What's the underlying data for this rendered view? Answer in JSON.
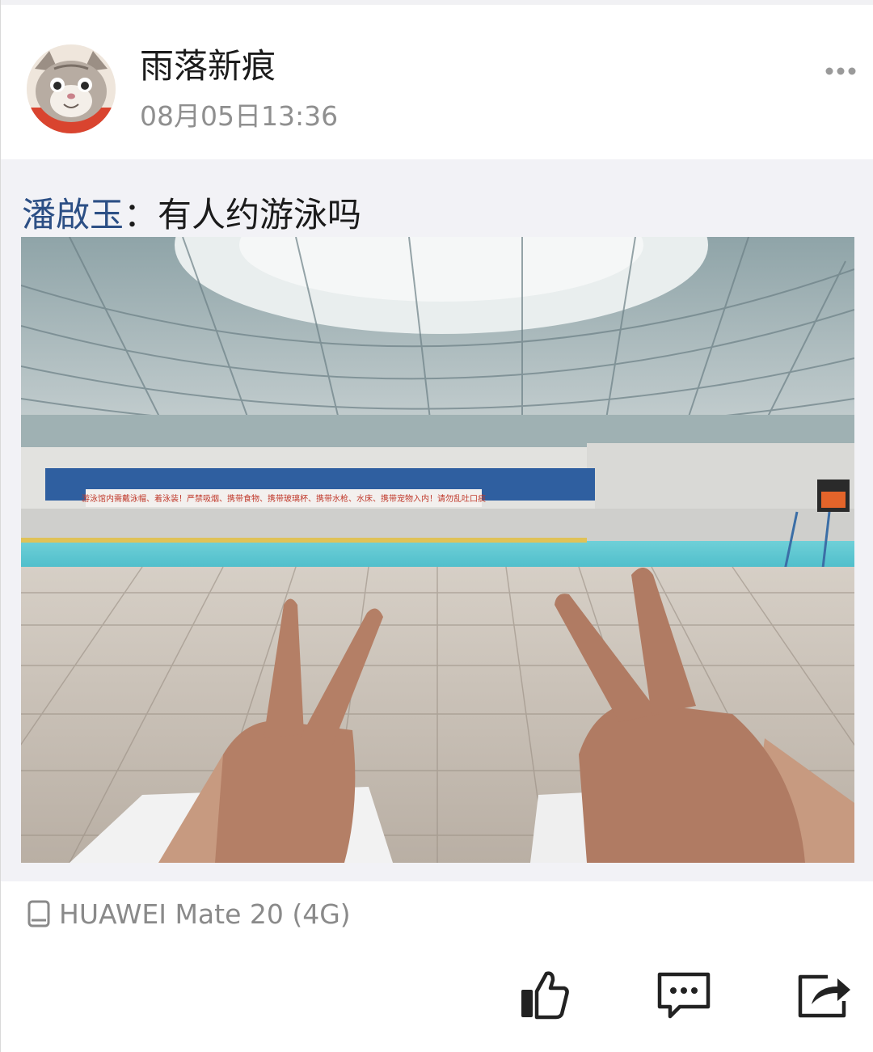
{
  "post": {
    "username": "雨落新痕",
    "timestamp": "08月05日13:36"
  },
  "repost": {
    "author": "潘啟玉",
    "separator": "：",
    "text": "有人约游泳吗",
    "banner_text": "游泳馆内需戴泳帽、着泳装！严禁吸烟、携带食物、携带玻璃杯、携带水枪、水床、携带宠物入内！请勿乱吐口痰"
  },
  "device": {
    "label": "HUAWEI Mate 20 (4G)",
    "icon": "phone-icon"
  },
  "icons": {
    "more": "more-dots-icon",
    "like": "thumbs-up-icon",
    "comment": "comment-bubble-icon",
    "share": "share-icon"
  },
  "colors": {
    "author_link": "#2c4f85",
    "repost_background": "#f2f2f6",
    "icon_dark": "#222222",
    "meta_gray": "#8f8f8f"
  }
}
